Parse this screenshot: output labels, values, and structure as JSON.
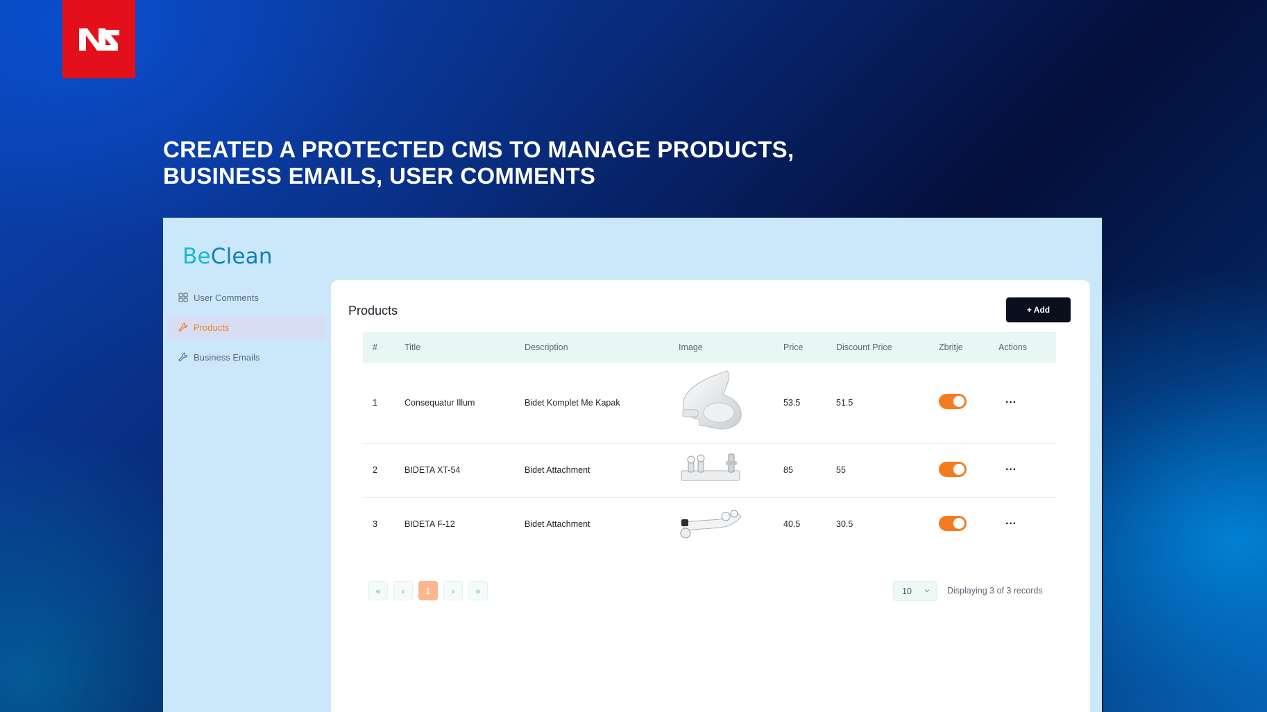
{
  "banner": {
    "headline_line1": "CREATED A PROTECTED CMS TO MANAGE PRODUCTS,",
    "headline_line2": "BUSINESS EMAILS, USER COMMENTS"
  },
  "brand": {
    "part1": "Be",
    "part2": "Clean"
  },
  "sidebar": {
    "items": [
      {
        "label": "User Comments",
        "icon": "grid-icon",
        "active": false
      },
      {
        "label": "Products",
        "icon": "wrench-icon",
        "active": true
      },
      {
        "label": "Business Emails",
        "icon": "wrench-icon",
        "active": false
      }
    ]
  },
  "main": {
    "title": "Products",
    "add_label": "+ Add",
    "columns": [
      "#",
      "Title",
      "Description",
      "Image",
      "Price",
      "Discount Price",
      "Zbritje",
      "Actions"
    ],
    "rows": [
      {
        "num": "1",
        "title": "Consequatur Illum",
        "description": "Bidet Komplet Me Kapak",
        "image": "toilet-seat-image",
        "price": "53.5",
        "discount": "51.5",
        "zbritje": true,
        "actions": "···"
      },
      {
        "num": "2",
        "title": "BIDETA XT-54",
        "description": "Bidet Attachment",
        "image": "bidet-attachment-image",
        "price": "85",
        "discount": "55",
        "zbritje": true,
        "actions": "···"
      },
      {
        "num": "3",
        "title": "BIDETA F-12",
        "description": "Bidet Attachment",
        "image": "bidet-attachment-image",
        "price": "40.5",
        "discount": "30.5",
        "zbritje": true,
        "actions": "···"
      }
    ],
    "pagination": {
      "first": "«",
      "prev": "‹",
      "current": "1",
      "next": "›",
      "last": "»",
      "page_size": "10",
      "records_text": "Displaying 3 of 3 records"
    }
  },
  "colors": {
    "accent_orange": "#f47c20",
    "logo_red": "#e3101b",
    "panel_bg": "#cbe8fb"
  }
}
